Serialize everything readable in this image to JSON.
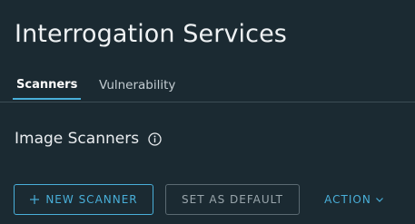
{
  "page": {
    "title": "Interrogation Services"
  },
  "tabs": [
    {
      "label": "Scanners",
      "active": true
    },
    {
      "label": "Vulnerability",
      "active": false
    }
  ],
  "section": {
    "title": "Image Scanners",
    "info_icon": "info-icon"
  },
  "toolbar": {
    "new_scanner_label": "NEW SCANNER",
    "new_scanner_icon": "plus-icon",
    "set_default_label": "SET AS DEFAULT",
    "action_label": "ACTION",
    "action_icon": "chevron-down-icon"
  },
  "colors": {
    "background": "#1b2a32",
    "accent": "#49afd9",
    "text": "#e9ecef",
    "muted": "#9aa6ac"
  }
}
